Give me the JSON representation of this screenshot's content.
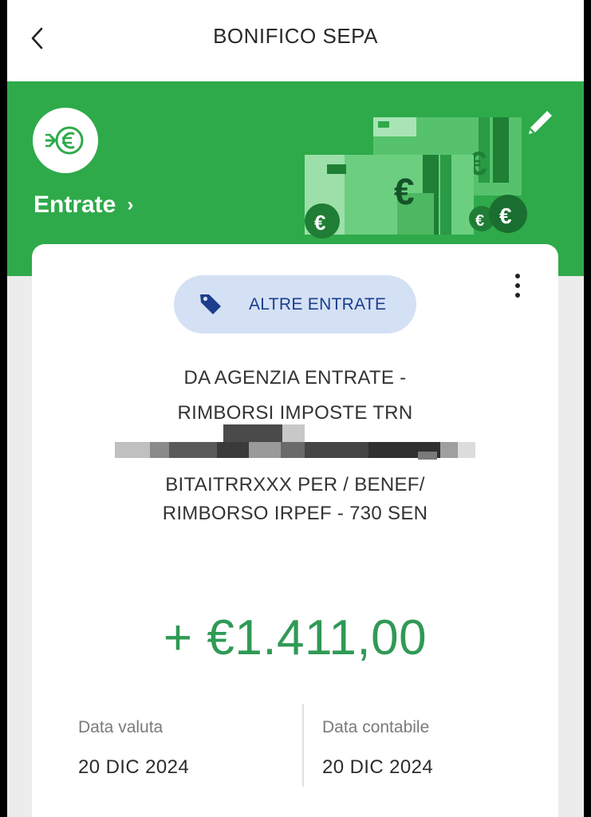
{
  "header": {
    "title": "BONIFICO SEPA"
  },
  "category": {
    "label": "Entrate",
    "icon": "incoming-euro-icon"
  },
  "colors": {
    "header_green": "#2eaa4a",
    "amount_green": "#2f9a55",
    "tag_bg": "#d4e1f5",
    "tag_text": "#1c3e8c"
  },
  "transaction": {
    "tag": "ALTRE ENTRATE",
    "description": {
      "line1": "DA AGENZIA ENTRATE -",
      "line2": "RIMBORSI IMPOSTE TRN",
      "line4": "BITAITRRXXX PER / BENEF/",
      "line5": "RIMBORSO IRPEF - 730 SEN"
    },
    "amount": "+ €1.411,00",
    "value_date_label": "Data valuta",
    "value_date": "20 DIC 2024",
    "accounting_date_label": "Data contabile",
    "accounting_date": "20 DIC 2024"
  }
}
